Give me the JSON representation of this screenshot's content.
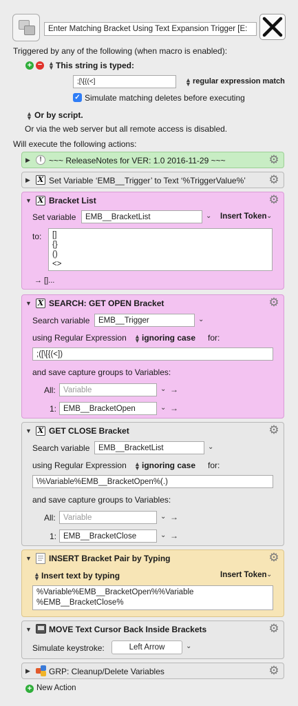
{
  "header": {
    "macro_name": "Enter Matching Bracket Using Text Expansion Trigger [E:"
  },
  "triggers": {
    "heading": "Triggered by any of the following (when macro is enabled):",
    "string_typed_label": "This string is typed:",
    "string_value": ";[\\[{(<]",
    "match_mode": "regular expression match",
    "simulate_label": "Simulate matching deletes before executing",
    "simulate_checked": true,
    "or_by_script": "Or by script.",
    "web_server": "Or via the web server but all remote access is disabled."
  },
  "actions_heading": "Will execute the following actions:",
  "actions": {
    "release_notes": {
      "title": "~~~ ReleaseNotes for  VER: 1.0    2016-11-29 ~~~",
      "color": "#c8edc4"
    },
    "set_variable": {
      "title": "Set Variable ‘EMB__Trigger’ to Text ‘%TriggerValue%’"
    },
    "bracket_list": {
      "title": "Bracket List",
      "set_variable_label": "Set variable",
      "variable": "EMB__BracketList",
      "insert_token": "Insert Token",
      "to_label": "to:",
      "lines": [
        "[]",
        "{}",
        "()",
        "<>"
      ],
      "footer": "→ []..."
    },
    "search_open": {
      "title": "SEARCH:  GET OPEN Bracket",
      "search_variable_label": "Search variable",
      "variable": "EMB__Trigger",
      "using_label": "using Regular Expression",
      "case_mode": "ignoring case",
      "for_label": "for:",
      "regex": ";([\\[{(<])",
      "capture_label": "and save capture groups to Variables:",
      "all_label": "All:",
      "all_placeholder": "Variable",
      "one_label": "1:",
      "one_value": "EMB__BracketOpen"
    },
    "get_close": {
      "title": "GET CLOSE Bracket",
      "search_variable_label": "Search variable",
      "variable": "EMB__BracketList",
      "using_label": "using Regular Expression",
      "case_mode": "ignoring case",
      "for_label": "for:",
      "regex": "\\%Variable%EMB__BracketOpen%(.)",
      "capture_label": "and save capture groups to Variables:",
      "all_label": "All:",
      "all_placeholder": "Variable",
      "one_label": "1:",
      "one_value": "EMB__BracketClose"
    },
    "insert_pair": {
      "title": "INSERT Bracket Pair by Typing",
      "mode": "Insert text by typing",
      "insert_token": "Insert Token",
      "line1": "%Variable%EMB__BracketOpen%%Variable",
      "line2": "%EMB__BracketClose%"
    },
    "move_cursor": {
      "title": "MOVE Text Cursor Back Inside Brackets",
      "simulate_label": "Simulate keystroke:",
      "keystroke": "Left Arrow"
    },
    "cleanup": {
      "title": "GRP:  Cleanup/Delete Variables"
    }
  },
  "footer": {
    "new_action": "New Action"
  }
}
